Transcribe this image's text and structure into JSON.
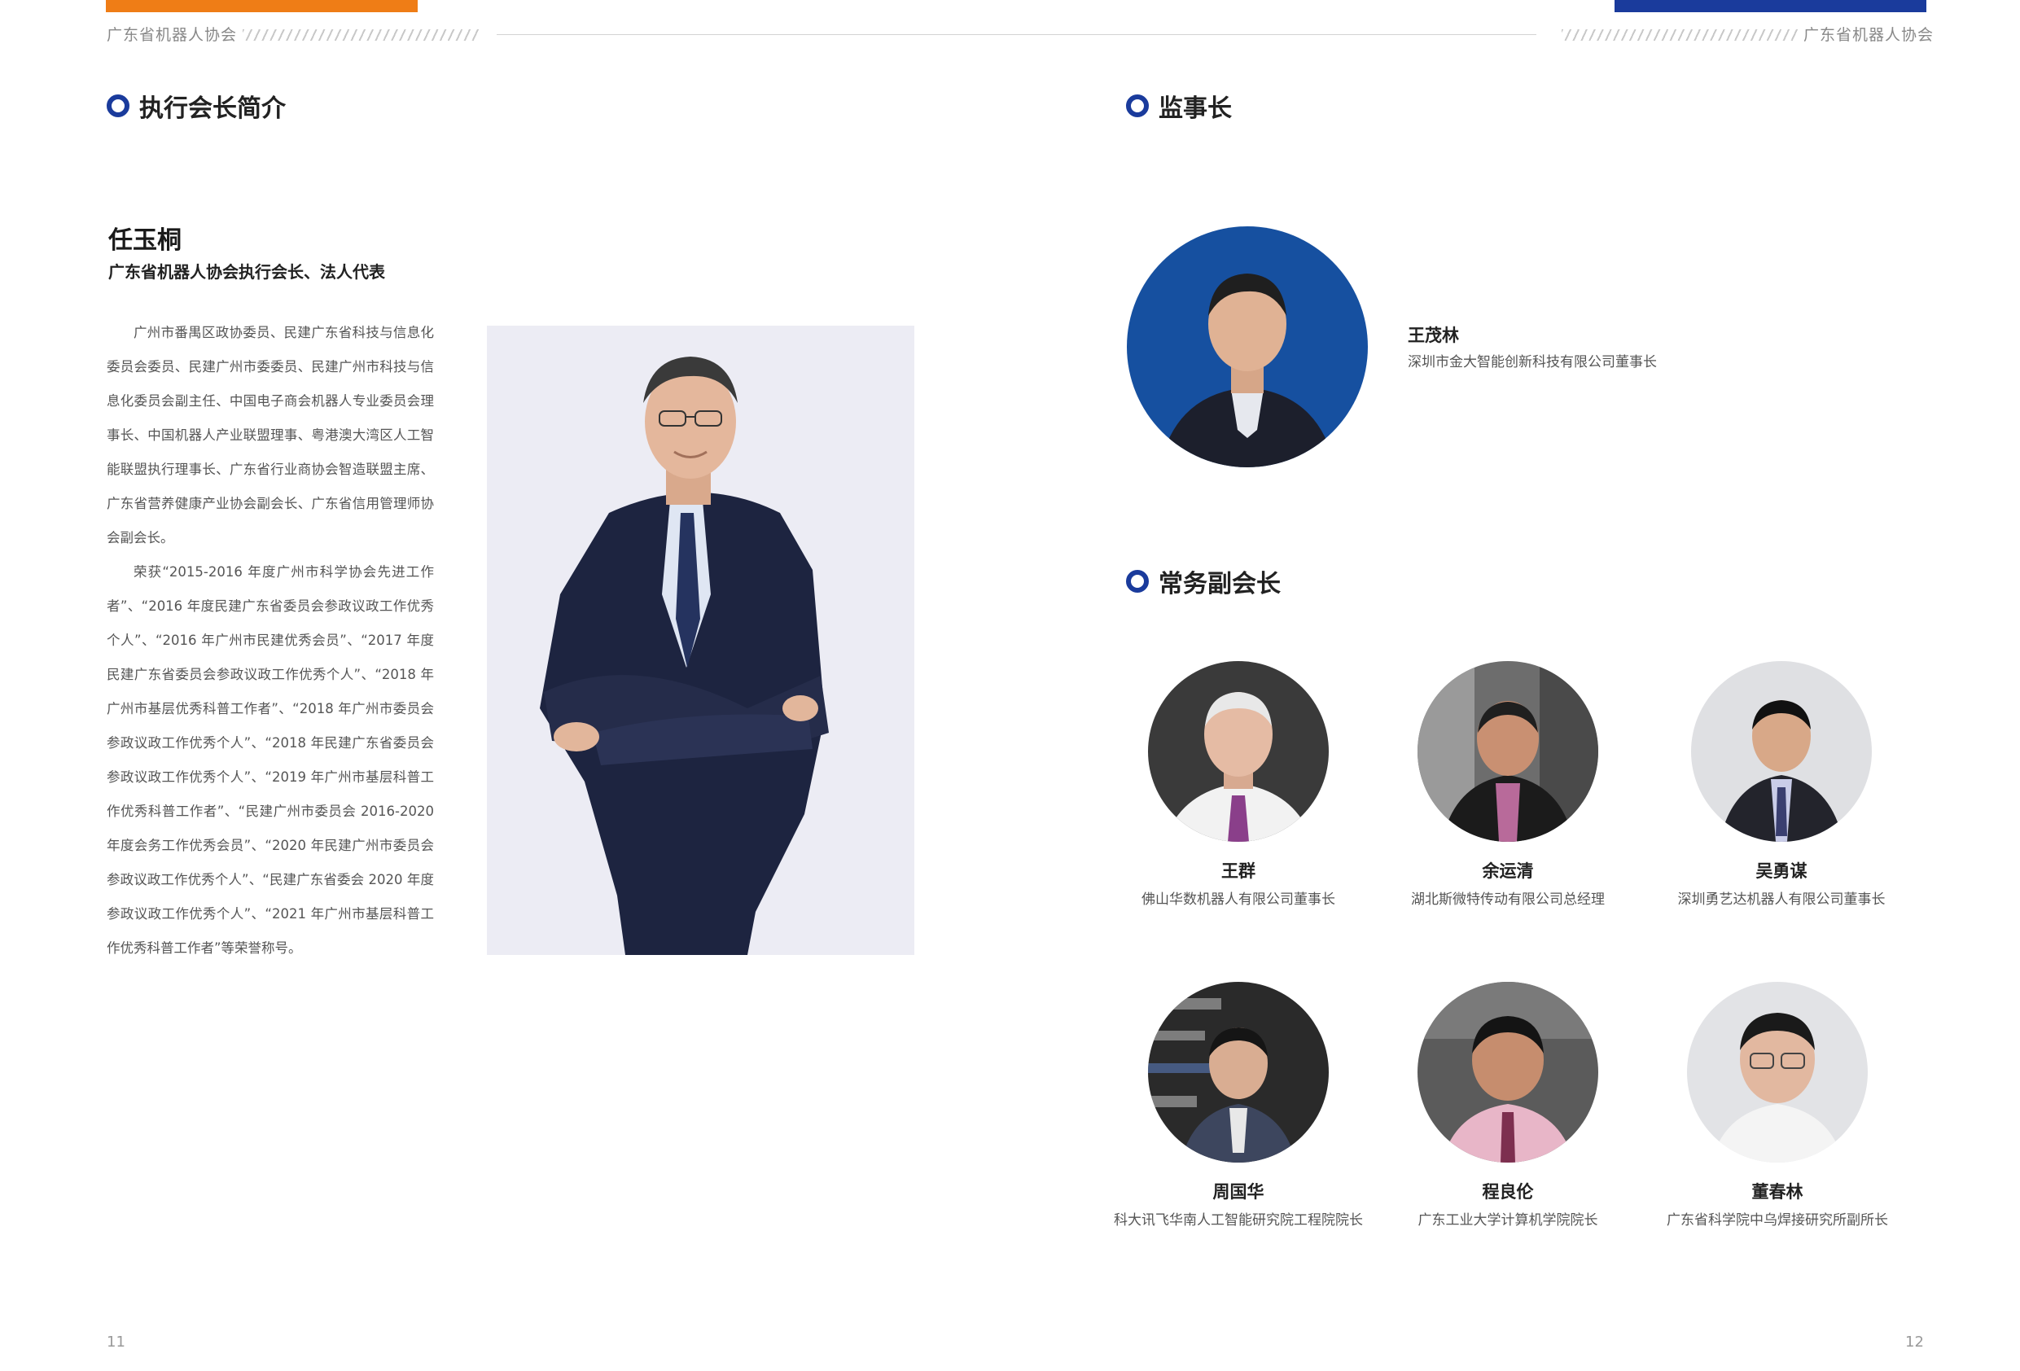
{
  "header": {
    "org_left": "广东省机器人协会",
    "org_right": "广东省机器人协会"
  },
  "left_page": {
    "section_title": "执行会长简介",
    "person_name": "任玉桐",
    "person_role": "广东省机器人协会执行会长、法人代表",
    "bio_paragraphs": [
      "广州市番禺区政协委员、民建广东省科技与信息化委员会委员、民建广州市委委员、民建广州市科技与信息化委员会副主任、中国电子商会机器人专业委员会理事长、中国机器人产业联盟理事、粤港澳大湾区人工智能联盟执行理事长、广东省行业商协会智造联盟主席、广东省营养健康产业协会副会长、广东省信用管理师协会副会长。",
      "荣获“2015-2016 年度广州市科学协会先进工作者”、“2016 年度民建广东省委员会参政议政工作优秀个人”、“2016 年广州市民建优秀会员”、“2017 年度民建广东省委员会参政议政工作优秀个人”、“2018 年广州市基层优秀科普工作者”、“2018 年广州市委员会参政议政工作优秀个人”、“2018 年民建广东省委员会参政议政工作优秀个人”、“2019 年广州市基层科普工作优秀科普工作者”、“民建广州市委员会 2016-2020 年度会务工作优秀会员”、“2020 年民建广州市委员会参政议政工作优秀个人”、“民建广东省委会 2020 年度参政议政工作优秀个人”、“2021 年广州市基层科普工作优秀科普工作者”等荣誉称号。"
    ],
    "page_number": "11"
  },
  "right_page": {
    "supervisor_section": "监事长",
    "supervisor": {
      "name": "王茂林",
      "title": "深圳市金大智能创新科技有限公司董事长"
    },
    "vp_section": "常务副会长",
    "vice_presidents": [
      {
        "name": "王群",
        "title": "佛山华数机器人有限公司董事长"
      },
      {
        "name": "余运清",
        "title": "湖北斯微特传动有限公司总经理"
      },
      {
        "name": "吴勇谋",
        "title": "深圳勇艺达机器人有限公司董事长"
      },
      {
        "name": "周国华",
        "title": "科大讯飞华南人工智能研究院工程院院长"
      },
      {
        "name": "程良伦",
        "title": "广东工业大学计算机学院院长"
      },
      {
        "name": "董春林",
        "title": "广东省科学院中乌焊接研究所副所长"
      }
    ],
    "page_number": "12"
  },
  "colors": {
    "accent_orange": "#ef7d16",
    "accent_blue": "#1a3b9c"
  }
}
